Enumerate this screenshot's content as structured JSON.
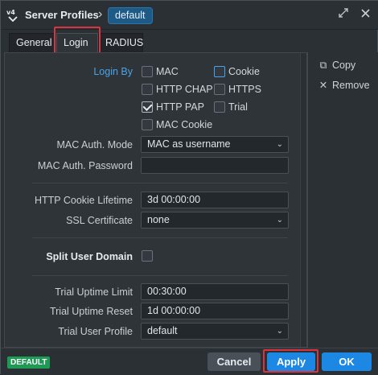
{
  "window": {
    "title": "Server Profiles",
    "separator": "›",
    "profile_name": "default"
  },
  "titlebar_icons": {
    "expand": "expand-icon",
    "close": "close-icon"
  },
  "tabs": [
    {
      "label": "General",
      "active": false
    },
    {
      "label": "Login",
      "active": true
    },
    {
      "label": "RADIUS",
      "active": false
    }
  ],
  "side_actions": [
    {
      "label": "Copy",
      "icon": "copy-icon",
      "glyph": "⧉"
    },
    {
      "label": "Remove",
      "icon": "remove-icon",
      "glyph": "✕"
    }
  ],
  "login_by": {
    "label": "Login By",
    "options": [
      {
        "label": "MAC",
        "checked": false
      },
      {
        "label": "Cookie",
        "checked": false
      },
      {
        "label": "HTTP CHAP",
        "checked": false
      },
      {
        "label": "HTTPS",
        "checked": false
      },
      {
        "label": "HTTP PAP",
        "checked": true
      },
      {
        "label": "Trial",
        "checked": false
      },
      {
        "label": "MAC Cookie",
        "checked": false
      }
    ]
  },
  "mac_auth_mode": {
    "label": "MAC Auth. Mode",
    "value": "MAC as username"
  },
  "mac_auth_password": {
    "label": "MAC Auth. Password",
    "value": ""
  },
  "http_cookie_lifetime": {
    "label": "HTTP Cookie Lifetime",
    "value": "3d 00:00:00"
  },
  "ssl_certificate": {
    "label": "SSL Certificate",
    "value": "none"
  },
  "split_user_domain": {
    "label": "Split User Domain",
    "checked": false
  },
  "trial_uptime_limit": {
    "label": "Trial Uptime Limit",
    "value": "00:30:00"
  },
  "trial_uptime_reset": {
    "label": "Trial Uptime Reset",
    "value": "1d 00:00:00"
  },
  "trial_user_profile": {
    "label": "Trial User Profile",
    "value": "default"
  },
  "footer": {
    "badge": "DEFAULT",
    "cancel": "Cancel",
    "apply": "Apply",
    "ok": "OK"
  },
  "colors": {
    "accent": "#1d87e4",
    "badge": "#1f9a55",
    "highlight_outline": "#d9343f",
    "section_label": "#4aa3e8"
  }
}
